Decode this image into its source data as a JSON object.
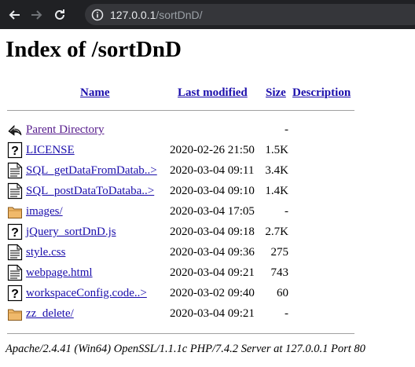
{
  "browser": {
    "url_host": "127.0.0.1",
    "url_path": "/sortDnD/"
  },
  "page": {
    "title": "Index of /sortDnD"
  },
  "columns": {
    "name": "Name",
    "last_modified": "Last modified",
    "size": "Size",
    "description": "Description"
  },
  "rows": [
    {
      "name": "Parent Directory",
      "date": "",
      "size": "-",
      "icon": "back-icon"
    },
    {
      "name": "LICENSE",
      "date": "2020-02-26 21:50",
      "size": "1.5K",
      "icon": "unknown-file-icon"
    },
    {
      "name": "SQL_getDataFromDatab..>",
      "date": "2020-03-04 09:11",
      "size": "3.4K",
      "icon": "text-file-icon"
    },
    {
      "name": "SQL_postDataToDataba..>",
      "date": "2020-03-04 09:10",
      "size": "1.4K",
      "icon": "text-file-icon"
    },
    {
      "name": "images/",
      "date": "2020-03-04 17:05",
      "size": "-",
      "icon": "folder-icon"
    },
    {
      "name": "jQuery_sortDnD.js",
      "date": "2020-03-04 09:18",
      "size": "2.7K",
      "icon": "unknown-file-icon"
    },
    {
      "name": "style.css",
      "date": "2020-03-04 09:36",
      "size": "275",
      "icon": "text-file-icon"
    },
    {
      "name": "webpage.html",
      "date": "2020-03-04 09:21",
      "size": "743",
      "icon": "text-file-icon"
    },
    {
      "name": "workspaceConfig.code..>",
      "date": "2020-03-02 09:40",
      "size": "60",
      "icon": "unknown-file-icon"
    },
    {
      "name": "zz_delete/",
      "date": "2020-03-04 09:21",
      "size": "-",
      "icon": "folder-icon"
    }
  ],
  "footer": {
    "address": "Apache/2.4.41 (Win64) OpenSSL/1.1.1c PHP/7.4.2 Server at 127.0.0.1 Port 80"
  }
}
